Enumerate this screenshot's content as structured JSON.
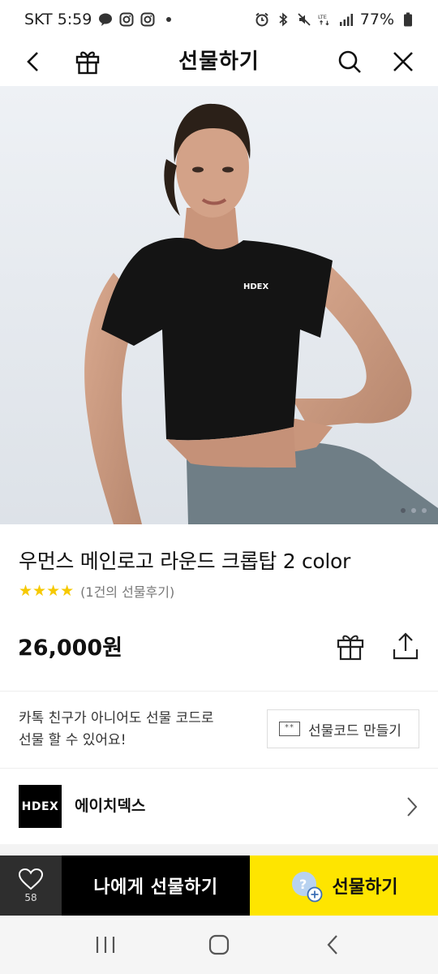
{
  "status_bar": {
    "carrier_time": "SKT 5:59",
    "battery": "77%",
    "left_icons": [
      "talk-icon",
      "instagram-icon",
      "instagram-icon"
    ],
    "right_icons": [
      "alarm-icon",
      "bluetooth-icon",
      "mute-icon",
      "lte-icon",
      "signal-icon",
      "battery-icon"
    ]
  },
  "header": {
    "title": "선물하기",
    "icons": [
      "back-icon",
      "gift-icon",
      "search-icon",
      "close-icon"
    ]
  },
  "hero": {
    "logo_text": "HDEX",
    "page_count": 3,
    "current_page": 1
  },
  "product": {
    "title": "우먼스 메인로고 라운드 크롭탑 2 color",
    "stars": "★★★★",
    "review_text": "(1건의 선물후기)",
    "price": "26,000원"
  },
  "gift_code": {
    "description": "카톡 친구가 아니어도 선물 코드로\n선물 할 수 있어요!",
    "button_label": "선물코드 만들기",
    "icon_text": "**"
  },
  "brand": {
    "logo_text": "HDEX",
    "name": "에이치덱스"
  },
  "bottom_bar": {
    "like_count": "58",
    "self_gift_label": "나에게 선물하기",
    "gift_label": "선물하기",
    "gift_icon_text": "?"
  },
  "colors": {
    "accent_yellow": "#FEE500",
    "dark": "#000000",
    "star": "#F6C900"
  }
}
